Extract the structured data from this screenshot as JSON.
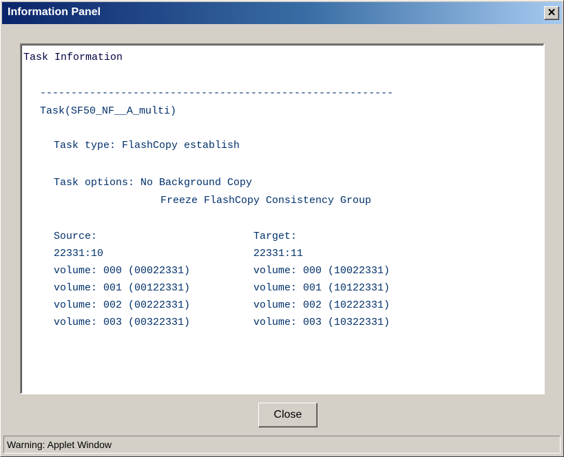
{
  "window": {
    "title": "Information Panel",
    "close_glyph": "✕"
  },
  "panel": {
    "heading": "Task Information",
    "separator": "---------------------------------------------------------",
    "task_name": "Task(SF50_NF__A_multi)",
    "task_type": "Task type: FlashCopy establish",
    "task_options_1": "Task options: No Background Copy",
    "task_options_2": "Freeze FlashCopy Consistency Group",
    "source": {
      "header": "Source:",
      "id": "22331:10",
      "volumes": [
        "volume: 000 (00022331)",
        "volume: 001 (00122331)",
        "volume: 002 (00222331)",
        "volume: 003 (00322331)"
      ]
    },
    "target": {
      "header": "Target:",
      "id": "22331:11",
      "volumes": [
        "volume: 000 (10022331)",
        "volume: 001 (10122331)",
        "volume: 002 (10222331)",
        "volume: 003 (10322331)"
      ]
    }
  },
  "buttons": {
    "close_label": "Close"
  },
  "status": {
    "text": "Warning: Applet Window"
  },
  "colors": {
    "text": "#00306a",
    "titlebar_start": "#0a246a",
    "titlebar_end": "#a6caf0"
  }
}
